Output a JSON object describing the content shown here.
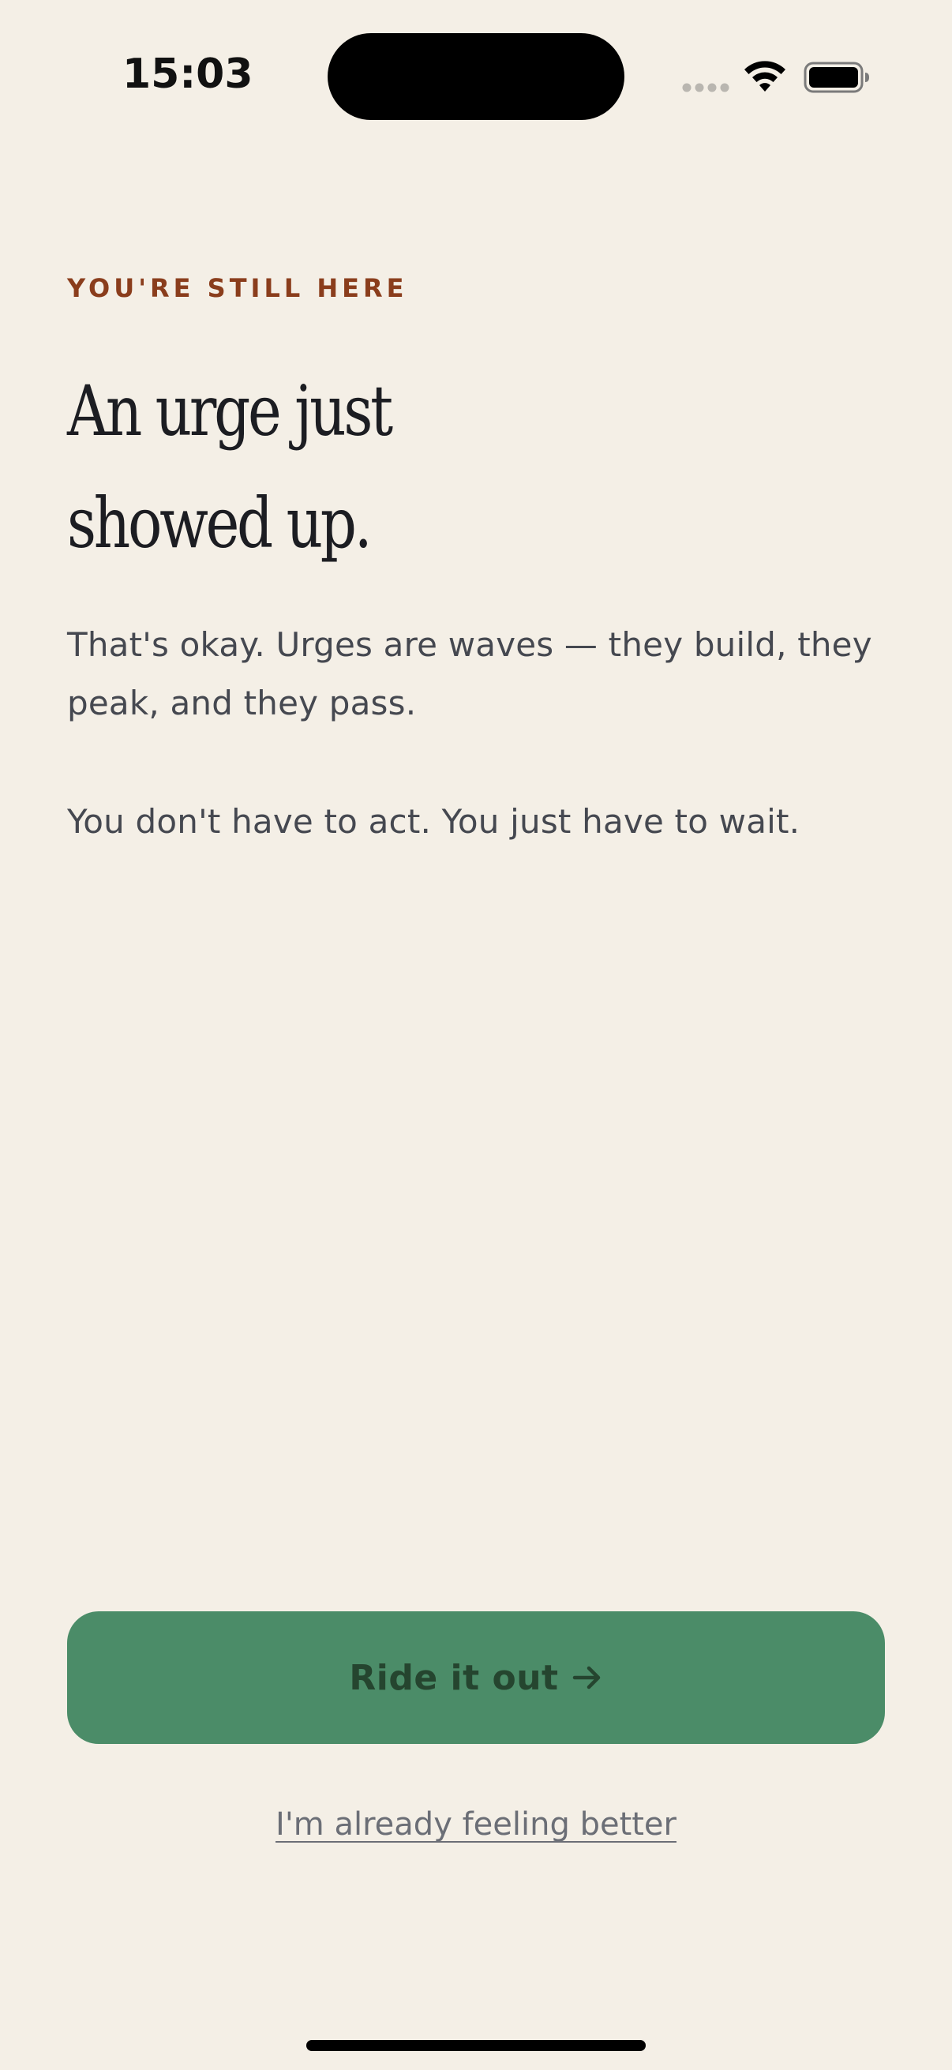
{
  "status_bar": {
    "time": "15:03",
    "icons": [
      "signal-dots-icon",
      "wifi-icon",
      "battery-icon"
    ]
  },
  "screen": {
    "eyebrow": "YOU'RE STILL HERE",
    "headline_line1": "An urge just",
    "headline_line2": "showed up.",
    "body_paragraph_1": "That's okay. Urges are waves — they build, they peak, and they pass.",
    "body_paragraph_2": "You don't have to act. You just have to wait."
  },
  "actions": {
    "primary_label": "Ride it out",
    "primary_icon": "arrow-right-icon",
    "secondary_label": "I'm already feeling better"
  },
  "colors": {
    "background": "#f4efe6",
    "accent_eyebrow": "#8a3d1c",
    "primary_button": "#4b8c68",
    "primary_button_text": "#25452f",
    "headline": "#1c1d22",
    "body_text": "#454850",
    "link_text": "#6b6e76"
  }
}
